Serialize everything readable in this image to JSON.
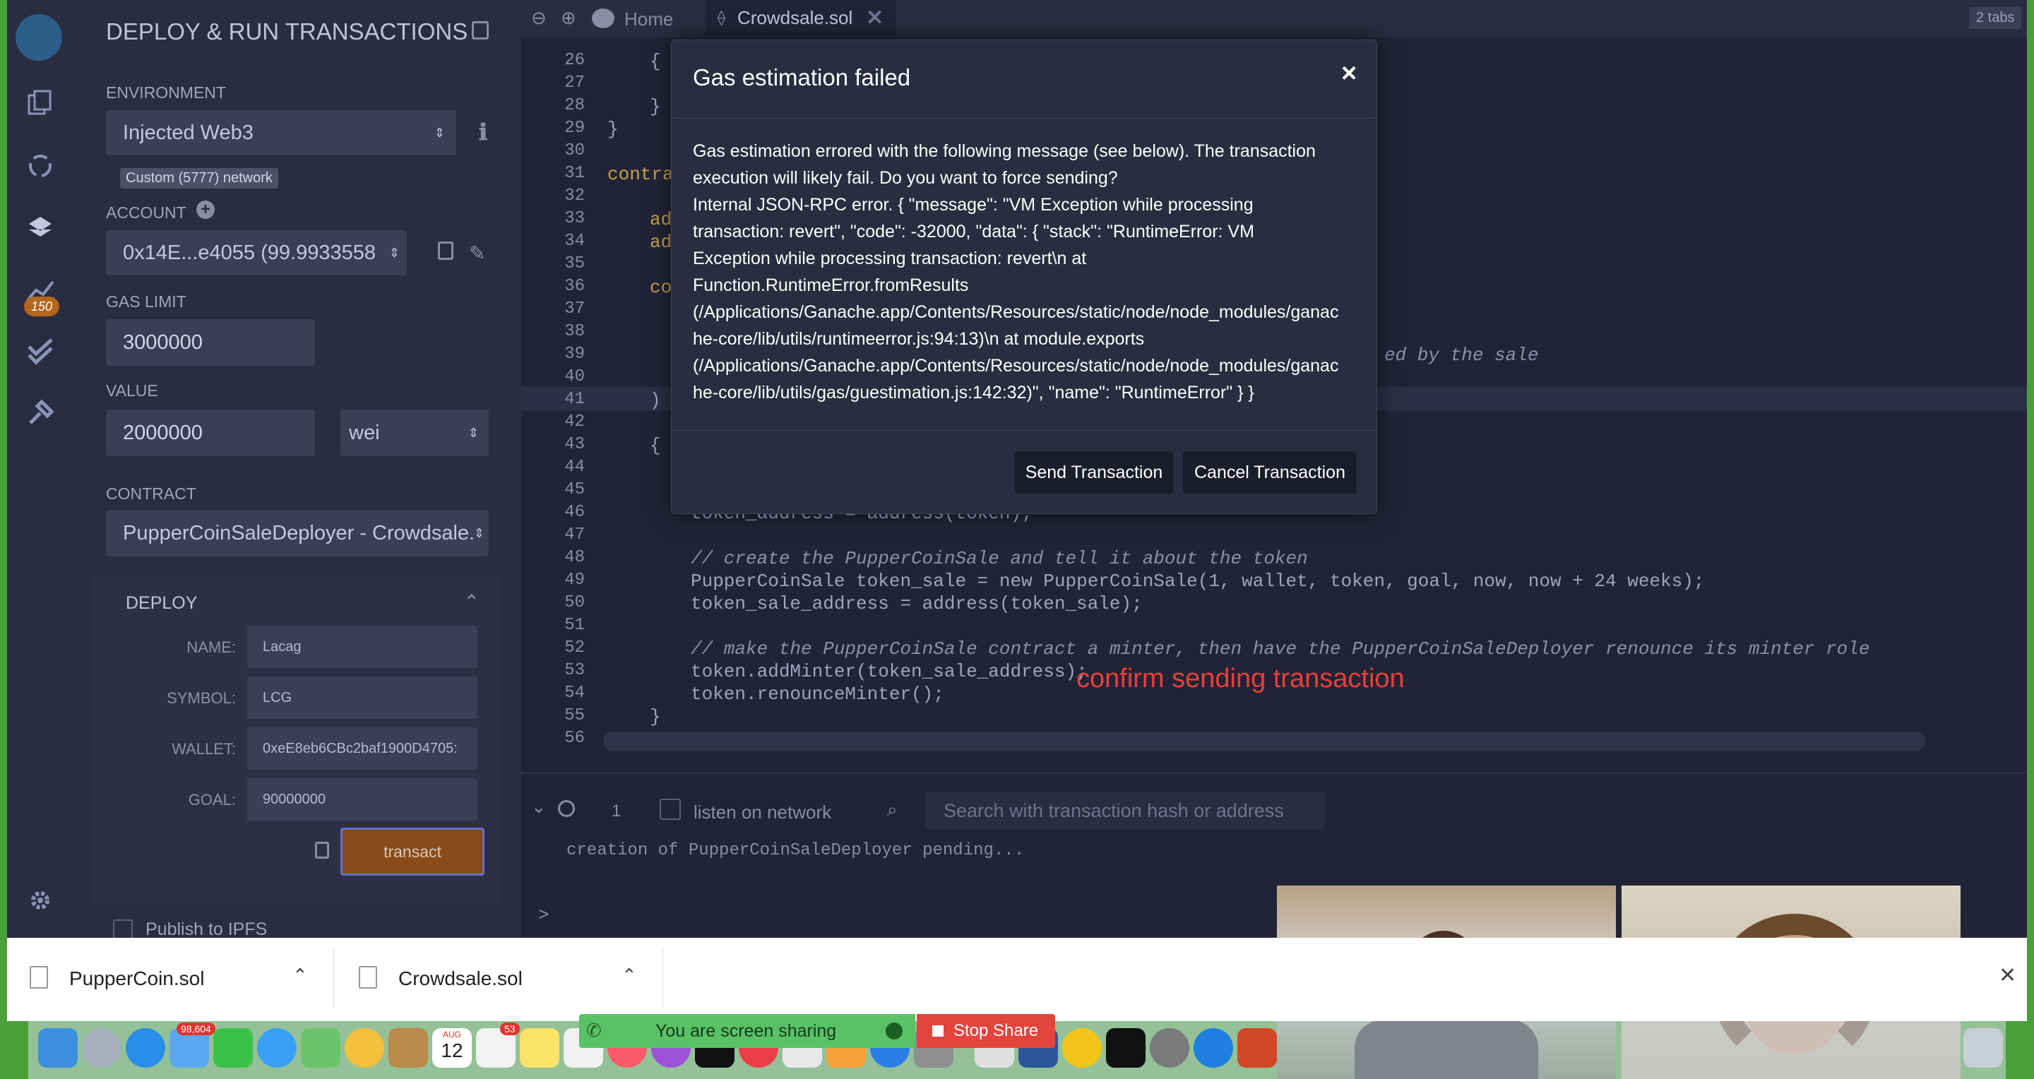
{
  "sidebar": {
    "title": "DEPLOY & RUN TRANSACTIONS",
    "badge_count": "150",
    "environment_label": "ENVIRONMENT",
    "environment_value": "Injected Web3",
    "network": "Custom (5777) network",
    "account_label": "ACCOUNT",
    "account_value": "0x14E...e4055 (99.9933558",
    "gas_limit_label": "GAS LIMIT",
    "gas_limit_value": "3000000",
    "value_label": "VALUE",
    "value_amount": "2000000",
    "value_unit": "wei",
    "contract_label": "CONTRACT",
    "contract_value": "PupperCoinSaleDeployer - Crowdsale.",
    "deploy_label": "DEPLOY",
    "fields": [
      {
        "label": "NAME:",
        "value": "Lacag"
      },
      {
        "label": "SYMBOL:",
        "value": "LCG"
      },
      {
        "label": "WALLET:",
        "value": "0xeE8eb6CBc2baf1900D4705:"
      },
      {
        "label": "GOAL:",
        "value": "90000000"
      }
    ],
    "transact_label": "transact",
    "publish_label": "Publish to IPFS"
  },
  "editor": {
    "home_tab": "Home",
    "file_tab": "Crowdsale.sol",
    "tabs_count": "2 tabs",
    "lines": [
      "26",
      "27",
      "28",
      "29",
      "30",
      "31",
      "32",
      "33",
      "34",
      "35",
      "36",
      "37",
      "38",
      "39",
      "40",
      "41",
      "42",
      "43",
      "44",
      "45",
      "46",
      "47",
      "48",
      "49",
      "50",
      "51",
      "52",
      "53",
      "54",
      "55",
      "56"
    ],
    "code": {
      "l26": "{",
      "l28": "}",
      "l29": "}",
      "l31": "contra",
      "l33": "add",
      "l34": "add",
      "l36": "con",
      "l39_tail": "ed by the sale",
      "l41": ")",
      "l43": "{",
      "l46": "token_address = address(token);",
      "l48": "// create the PupperCoinSale and tell it about the token",
      "l49": "PupperCoinSale token_sale = new PupperCoinSale(1, wallet, token, goal, now, now + 24 weeks);",
      "l50": "token_sale_address = address(token_sale);",
      "l52": "// make the PupperCoinSale contract a minter, then have the PupperCoinSaleDeployer renounce its minter role",
      "l53": "token.addMinter(token_sale_address);",
      "l54": "token.renounceMinter();",
      "l55": "}"
    },
    "annotation": "confirm sending transaction"
  },
  "modal": {
    "title": "Gas estimation failed",
    "close": "×",
    "body": [
      "Gas estimation errored with the following message (see below). The transaction",
      "execution will likely fail. Do you want to force sending?",
      "Internal JSON-RPC error. { \"message\": \"VM Exception while processing",
      "transaction: revert\", \"code\": -32000, \"data\": { \"stack\": \"RuntimeError: VM",
      "Exception while processing transaction: revert\\n at",
      "Function.RuntimeError.fromResults",
      "(/Applications/Ganache.app/Contents/Resources/static/node/node_modules/ganac",
      "he-core/lib/utils/runtimeerror.js:94:13)\\n at module.exports",
      "(/Applications/Ganache.app/Contents/Resources/static/node/node_modules/ganac",
      "he-core/lib/utils/gas/guestimation.js:142:32)\", \"name\": \"RuntimeError\" } }"
    ],
    "send_label": "Send Transaction",
    "cancel_label": "Cancel Transaction"
  },
  "terminal": {
    "count": "1",
    "listen_label": "listen on network",
    "search_placeholder": "Search with transaction hash or address",
    "log": "creation of PupperCoinSaleDeployer pending...",
    "prompt": ">"
  },
  "downloads": [
    {
      "name": "PupperCoin.sol"
    },
    {
      "name": "Crowdsale.sol"
    }
  ],
  "sharing": {
    "message": "You are screen sharing",
    "stop_label": "Stop Share"
  },
  "dock": {
    "mail_badge": "98,604",
    "calendar_month": "AUG",
    "calendar_day": "12",
    "reminders_badge": "53"
  }
}
